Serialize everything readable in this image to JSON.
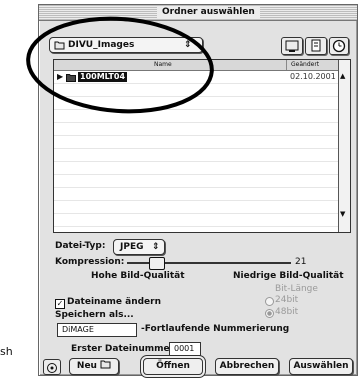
{
  "side_text": "sh",
  "window": {
    "title": "Ordner auswählen"
  },
  "location": {
    "folder_name": "DIVU_Images"
  },
  "list": {
    "col_name": "Name",
    "col_changed": "Geändert",
    "sort_indicator": "▲",
    "rows": [
      {
        "name": "100MLT04",
        "date": "02.10.2001"
      }
    ]
  },
  "options": {
    "file_type_label": "Datei-Typ:",
    "file_type_value": "JPEG",
    "compression_label": "Kompression:",
    "compression_value": "21",
    "quality_high": "Hohe Bild-Qualität",
    "quality_low": "Niedrige Bild-Qualität",
    "bit_length_label": "Bit-Länge",
    "bit_24": "24bit",
    "bit_48": "48bit",
    "rename_label": "Dateiname ändern",
    "save_as_label": "Speichern als...",
    "filename_value": "DiMAGE",
    "numbering_label": "-Fortlaufende Nummerierung",
    "first_number_label": "Erster Dateinummer",
    "first_number_value": "0001"
  },
  "buttons": {
    "new": "Neu",
    "open": "Öffnen",
    "cancel": "Abbrechen",
    "choose": "Auswählen"
  }
}
